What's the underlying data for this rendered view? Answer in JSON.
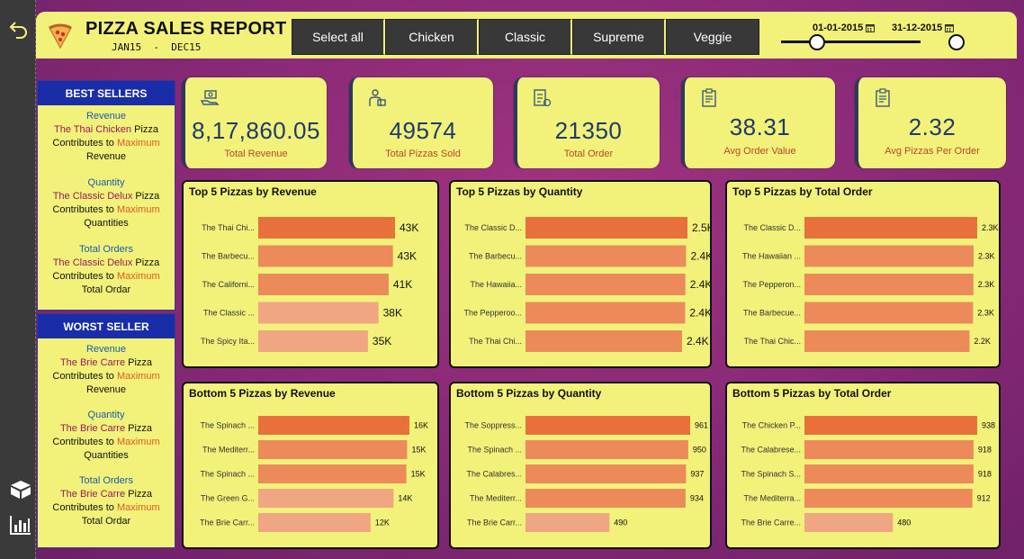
{
  "header": {
    "title": "PIZZA SALES REPORT",
    "subtitle": "JAN15  -  DEC15",
    "filters": [
      "Select all",
      "Chicken",
      "Classic",
      "Supreme",
      "Veggie"
    ],
    "date_start": "01-01-2015",
    "date_end": "31-12-2015"
  },
  "best": {
    "heading": "BEST SELLERS",
    "blocks": [
      {
        "cat": "Revenue",
        "pizza": "The Thai Chicken",
        "pizza_word": " Pizza",
        "contrib": "Contributes to ",
        "max": "Maximum",
        "metric": "Revenue"
      },
      {
        "cat": "Quantity",
        "pizza": "The Classic Delux",
        "pizza_word": " Pizza",
        "contrib": "Contributes to ",
        "max": "Maximum",
        "metric": "Quantities"
      },
      {
        "cat": "Total Orders",
        "pizza": "The Classic Delux",
        "pizza_word": " Pizza",
        "contrib": "Contributes to ",
        "max": "Maximum",
        "metric": "Total Ordar"
      }
    ]
  },
  "worst": {
    "heading": "WORST SELLER",
    "blocks": [
      {
        "cat": "Revenue",
        "pizza": "The Brie Carre",
        "pizza_word": " Pizza",
        "contrib": "Contributes to ",
        "max": "Maximum",
        "metric": "Revenue"
      },
      {
        "cat": "Quantity",
        "pizza": "The Brie Carre",
        "pizza_word": " Pizza",
        "contrib": "Contributes to ",
        "max": "Maximum",
        "metric": "Quantities"
      },
      {
        "cat": "Total Orders",
        "pizza": "The Brie Carre",
        "pizza_word": " Pizza",
        "contrib": "Contributes to ",
        "max": "Maximum",
        "metric": "Total Ordar"
      }
    ]
  },
  "kpis": [
    {
      "value": "8,17,860.05",
      "label": "Total Revenue",
      "icon": "money-hand-icon"
    },
    {
      "value": "49574",
      "label": "Total Pizzas Sold",
      "icon": "delivery-person-icon"
    },
    {
      "value": "21350",
      "label": "Total Order",
      "icon": "order-list-icon"
    },
    {
      "value": "38.31",
      "label": "Avg Order Value",
      "icon": "clipboard-icon"
    },
    {
      "value": "2.32",
      "label": "Avg Pizzas Per Order",
      "icon": "clipboard-icon"
    }
  ],
  "colors": {
    "panel": "#f2f17a",
    "bar_dark": "#e8703a",
    "bar_mid": "#ec8a5a",
    "bar_light": "#f0a682",
    "kpi_value": "#1e3a6a"
  },
  "chart_data": [
    {
      "type": "bar",
      "title": "Top 5 Pizzas by Revenue",
      "categories": [
        "The Thai Chi...",
        "The Barbecu...",
        "The Californi...",
        "The Classic ...",
        "The Spicy Ita..."
      ],
      "values": [
        43434,
        42768,
        41410,
        38180,
        34831
      ],
      "labels": [
        "43K",
        "43K",
        "41K",
        "38K",
        "35K"
      ]
    },
    {
      "type": "bar",
      "title": "Top 5 Pizzas by Quantity",
      "categories": [
        "The Classic D...",
        "The Barbecu...",
        "The Hawaiia...",
        "The Pepperoo...",
        "The Thai Chi..."
      ],
      "values": [
        2453,
        2432,
        2422,
        2418,
        2371
      ],
      "labels": [
        "2.5K",
        "2.4K",
        "2.4K",
        "2.4K",
        "2.4K"
      ]
    },
    {
      "type": "bar",
      "title": "Top 5 Pizzas by Total Order",
      "categories": [
        "The Classic D...",
        "The Hawaiian ...",
        "The Pepperon...",
        "The Barbecue...",
        "The Thai Chic..."
      ],
      "values": [
        2329,
        2280,
        2278,
        2273,
        2225
      ],
      "labels": [
        "2.3K",
        "2.3K",
        "2.3K",
        "2.3K",
        "2.2K"
      ]
    },
    {
      "type": "bar",
      "title": "Bottom 5 Pizzas by Revenue",
      "categories": [
        "The Spinach ...",
        "The Mediterr...",
        "The Spinach ...",
        "The Green G...",
        "The Brie Carr..."
      ],
      "values": [
        15596,
        15360,
        15277,
        13956,
        11588
      ],
      "labels": [
        "16K",
        "15K",
        "15K",
        "14K",
        "12K"
      ]
    },
    {
      "type": "bar",
      "title": "Bottom 5 Pizzas by Quantity",
      "categories": [
        "The Soppress...",
        "The Spinach ...",
        "The Calabres...",
        "The Mediterr...",
        "The Brie Carr..."
      ],
      "values": [
        961,
        950,
        937,
        934,
        490
      ],
      "labels": [
        "961",
        "950",
        "937",
        "934",
        "490"
      ]
    },
    {
      "type": "bar",
      "title": "Bottom 5 Pizzas by Total Order",
      "categories": [
        "The Chicken P...",
        "The Calabrese...",
        "The Spinach S...",
        "The Mediterra...",
        "The Brie Carre..."
      ],
      "values": [
        938,
        918,
        918,
        912,
        480
      ],
      "labels": [
        "938",
        "918",
        "918",
        "912",
        "480"
      ]
    }
  ]
}
